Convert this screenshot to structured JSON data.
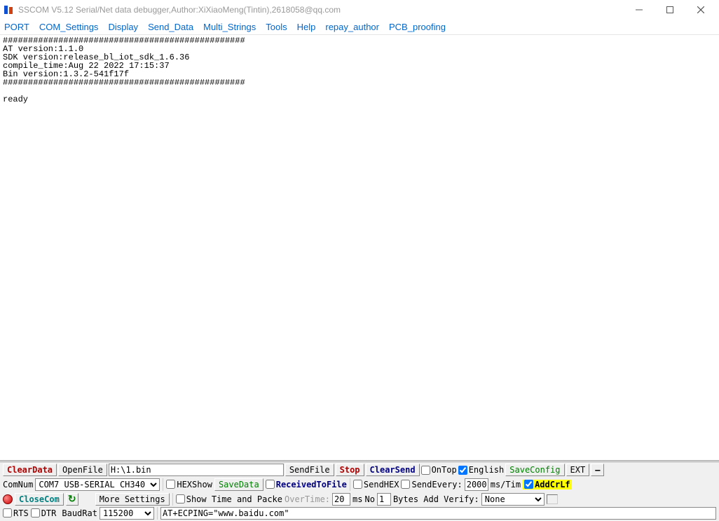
{
  "titlebar": {
    "text": "SSCOM V5.12 Serial/Net data debugger,Author:XiXiaoMeng(Tintin),2618058@qq.com"
  },
  "menu": {
    "port": "PORT",
    "com_settings": "COM_Settings",
    "display": "Display",
    "send_data": "Send_Data",
    "multi_strings": "Multi_Strings",
    "tools": "Tools",
    "help": "Help",
    "repay_author": "repay_author",
    "pcb_proofing": "PCB_proofing"
  },
  "console_output": "################################################\nAT version:1.1.0\nSDK version:release_bl_iot_sdk_1.6.36\ncompile_time:Aug 22 2022 17:15:37\nBin version:1.3.2-541f17f\n################################################\n\nready\n",
  "row1": {
    "clear_data": "ClearData",
    "open_file": "OpenFile",
    "file_path": "H:\\1.bin",
    "send_file": "SendFile",
    "stop": "Stop",
    "clear_send": "ClearSend",
    "on_top": "OnTop",
    "english": "English",
    "save_config": "SaveConfig",
    "ext": "EXT",
    "hide": "—"
  },
  "row2": {
    "comnum_label": "ComNum",
    "comnum_value": "COM7 USB-SERIAL CH340",
    "hex_show": "HEXShow",
    "save_data": "SaveData",
    "received_to_file": "ReceivedToFile",
    "send_hex": "SendHEX",
    "send_every": "SendEvery:",
    "interval_value": "2000",
    "interval_unit": "ms/Tim",
    "add_crlf": "AddCrLf"
  },
  "row3": {
    "close_com": "CloseCom",
    "more_settings": "More Settings",
    "show_time": "Show Time and Packe",
    "overtime_label": "OverTime:",
    "overtime_value": "20",
    "overtime_unit": "ms",
    "no_label": "No",
    "no_value": "1",
    "bytes_verify": "Bytes Add Verify:",
    "verify_value": "None"
  },
  "row4": {
    "rts": "RTS",
    "dtr": "DTR",
    "baud_label": "BaudRat",
    "baud_value": "115200",
    "send_text": "AT+ECPING=\"www.baidu.com\""
  }
}
